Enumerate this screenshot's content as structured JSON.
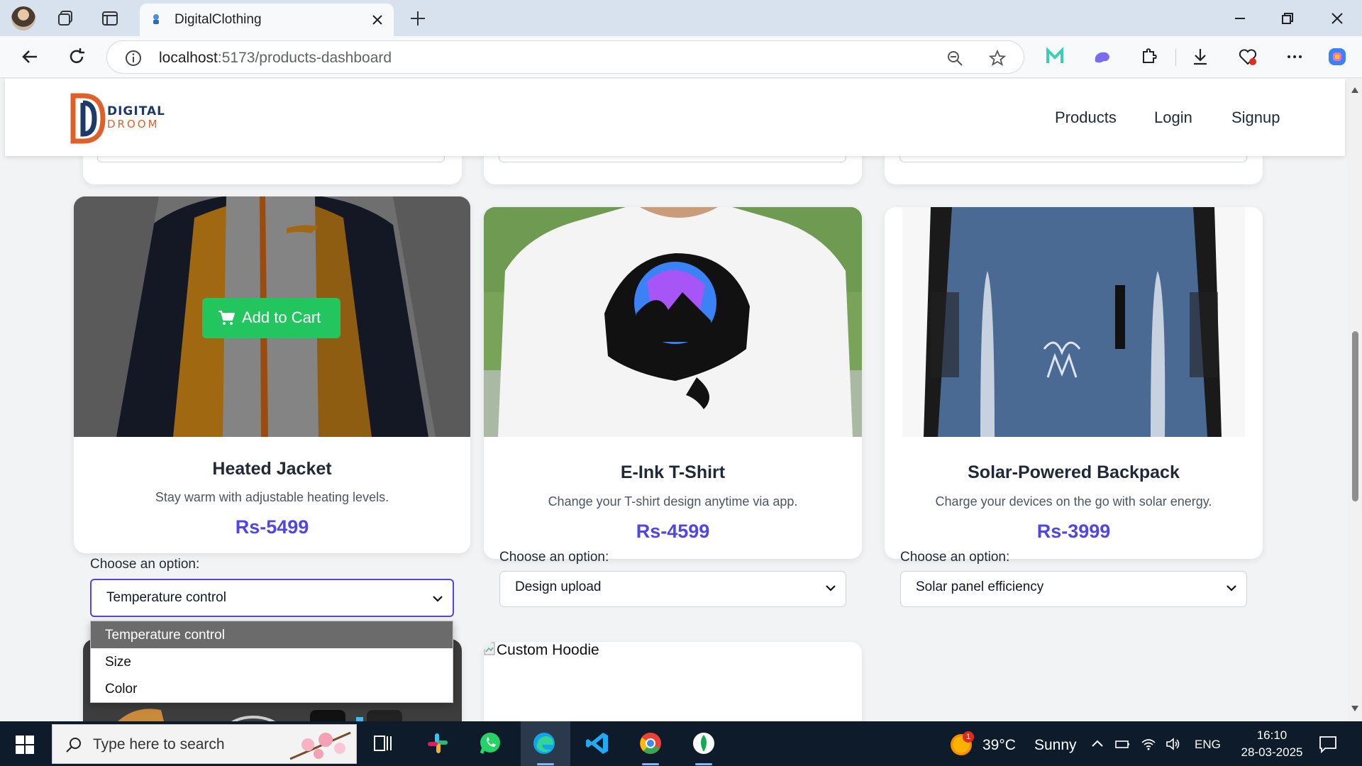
{
  "browser": {
    "tab_title": "DigitalClothing",
    "url_host": "localhost",
    "url_rest": ":5173/products-dashboard"
  },
  "site": {
    "logo_line1": "DIGITAL",
    "logo_line2": "DROOM",
    "nav": [
      "Products",
      "Login",
      "Signup"
    ]
  },
  "products": [
    {
      "title": "Heated Jacket",
      "description": "Stay warm with adjustable heating levels.",
      "price": "Rs-5499",
      "option_label": "Choose an option:",
      "selected_option": "Temperature control",
      "add_to_cart_label": "Add to Cart",
      "dropdown_options": [
        "Temperature control",
        "Size",
        "Color"
      ]
    },
    {
      "title": "E-Ink T-Shirt",
      "description": "Change your T-shirt design anytime via app.",
      "price": "Rs-4599",
      "option_label": "Choose an option:",
      "selected_option": "Design upload"
    },
    {
      "title": "Solar-Powered Backpack",
      "description": "Charge your devices on the go with solar energy.",
      "price": "Rs-3999",
      "option_label": "Choose an option:",
      "selected_option": "Solar panel efficiency"
    },
    {
      "broken_image_alt": "Custom Hoodie"
    }
  ],
  "taskbar": {
    "search_placeholder": "Type here to search",
    "weather_badge": "1",
    "temperature": "39°C",
    "condition": "Sunny",
    "language": "ENG",
    "time": "16:10",
    "date": "28-03-2025"
  },
  "colors": {
    "accent_price": "#4f46e5",
    "add_to_cart": "#22c55e",
    "taskbar_bg": "#0d1b2a"
  }
}
